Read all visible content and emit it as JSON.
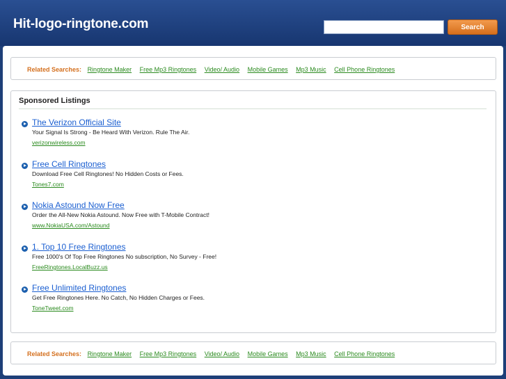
{
  "header": {
    "site_title": "Hit-logo-ringtone.com",
    "search_placeholder": "",
    "search_button": "Search"
  },
  "related_top": {
    "label": "Related Searches:",
    "links": [
      "Ringtone Maker",
      "Free Mp3 Ringtones",
      "Video/ Audio",
      "Mobile Games",
      "Mp3 Music",
      "Cell Phone Ringtones"
    ]
  },
  "sponsored": {
    "title": "Sponsored Listings",
    "listings": [
      {
        "title": "The Verizon Official Site",
        "description": "Your Signal Is Strong - Be Heard With Verizon. Rule The Air.",
        "url": "verizonwireless.com"
      },
      {
        "title": "Free Cell Ringtones",
        "description": "Download Free Cell Ringtones! No Hidden Costs or Fees.",
        "url": "Tones7.com"
      },
      {
        "title": "Nokia Astound Now Free",
        "description": "Order the All-New Nokia Astound. Now Free with T-Mobile Contract!",
        "url": "www.NokiaUSA.com/Astound"
      },
      {
        "title": "1. Top 10 Free Ringtones",
        "description": "Free 1000's Of Top Free Ringtones No subscription, No Survey - Free!",
        "url": "FreeRingtones.LocalBuzz.us"
      },
      {
        "title": "Free Unlimited Ringtones",
        "description": "Get Free Ringtones Here. No Catch, No Hidden Charges or Fees.",
        "url": "ToneTweet.com"
      }
    ]
  },
  "related_bottom": {
    "label": "Related Searches:",
    "links": [
      "Ringtone Maker",
      "Free Mp3 Ringtones",
      "Video/ Audio",
      "Mobile Games",
      "Mp3 Music",
      "Cell Phone Ringtones"
    ]
  }
}
